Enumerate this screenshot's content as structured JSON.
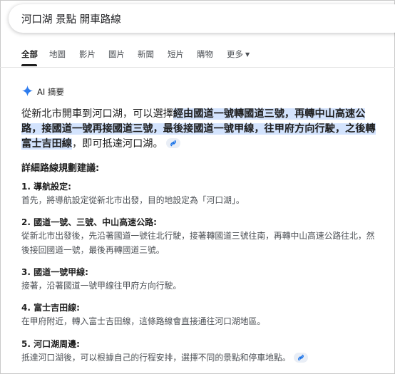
{
  "search": {
    "query": "河口湖 景點 開車路線"
  },
  "tabs": [
    {
      "label": "全部"
    },
    {
      "label": "地圖"
    },
    {
      "label": "影片"
    },
    {
      "label": "圖片"
    },
    {
      "label": "新聞"
    },
    {
      "label": "短片"
    },
    {
      "label": "購物"
    },
    {
      "label": "更多"
    }
  ],
  "ai_overview": {
    "label": "AI 摘要",
    "intro_prefix": "從新北市開車到河口湖，可以選擇",
    "intro_highlight_1": "經由國道一號轉國道三號，再轉中山高速公路，接國道一號再接國道三號，最後接國道一號甲線，往甲府方向行駛，之後轉",
    "intro_highlight_2": "富士吉田線",
    "intro_suffix": "，即可抵達河口湖。",
    "section_title": "詳細路線規劃建議:",
    "steps": [
      {
        "title": "1. 導航設定:",
        "body": "首先，將導航設定從新北市出發，目的地設定為「河口湖」。"
      },
      {
        "title": "2. 國道一號、三號、中山高速公路:",
        "body": "從新北市出發後，先沿著國道一號往北行駛，接著轉國道三號往南，再轉中山高速公路往北，然後接回國道一號，最後再轉國道三號。"
      },
      {
        "title": "3. 國道一號甲線:",
        "body": "接著，沿著國道一號甲線往甲府方向行駛。"
      },
      {
        "title": "4. 富士吉田線:",
        "body": "在甲府附近，轉入富士吉田線，這條路線會直接通往河口湖地區。"
      },
      {
        "title": "5. 河口湖周邊:",
        "body": "抵達河口湖後，可以根據自己的行程安排，選擇不同的景點和停車地點。"
      }
    ]
  },
  "colors": {
    "highlight": "#d3e3fd",
    "accent_blue": "#4285f4",
    "muted_text": "#4d5156"
  },
  "icons": {
    "ai": "sparkle-icon",
    "link": "link-icon",
    "more": "caret-down-icon"
  }
}
